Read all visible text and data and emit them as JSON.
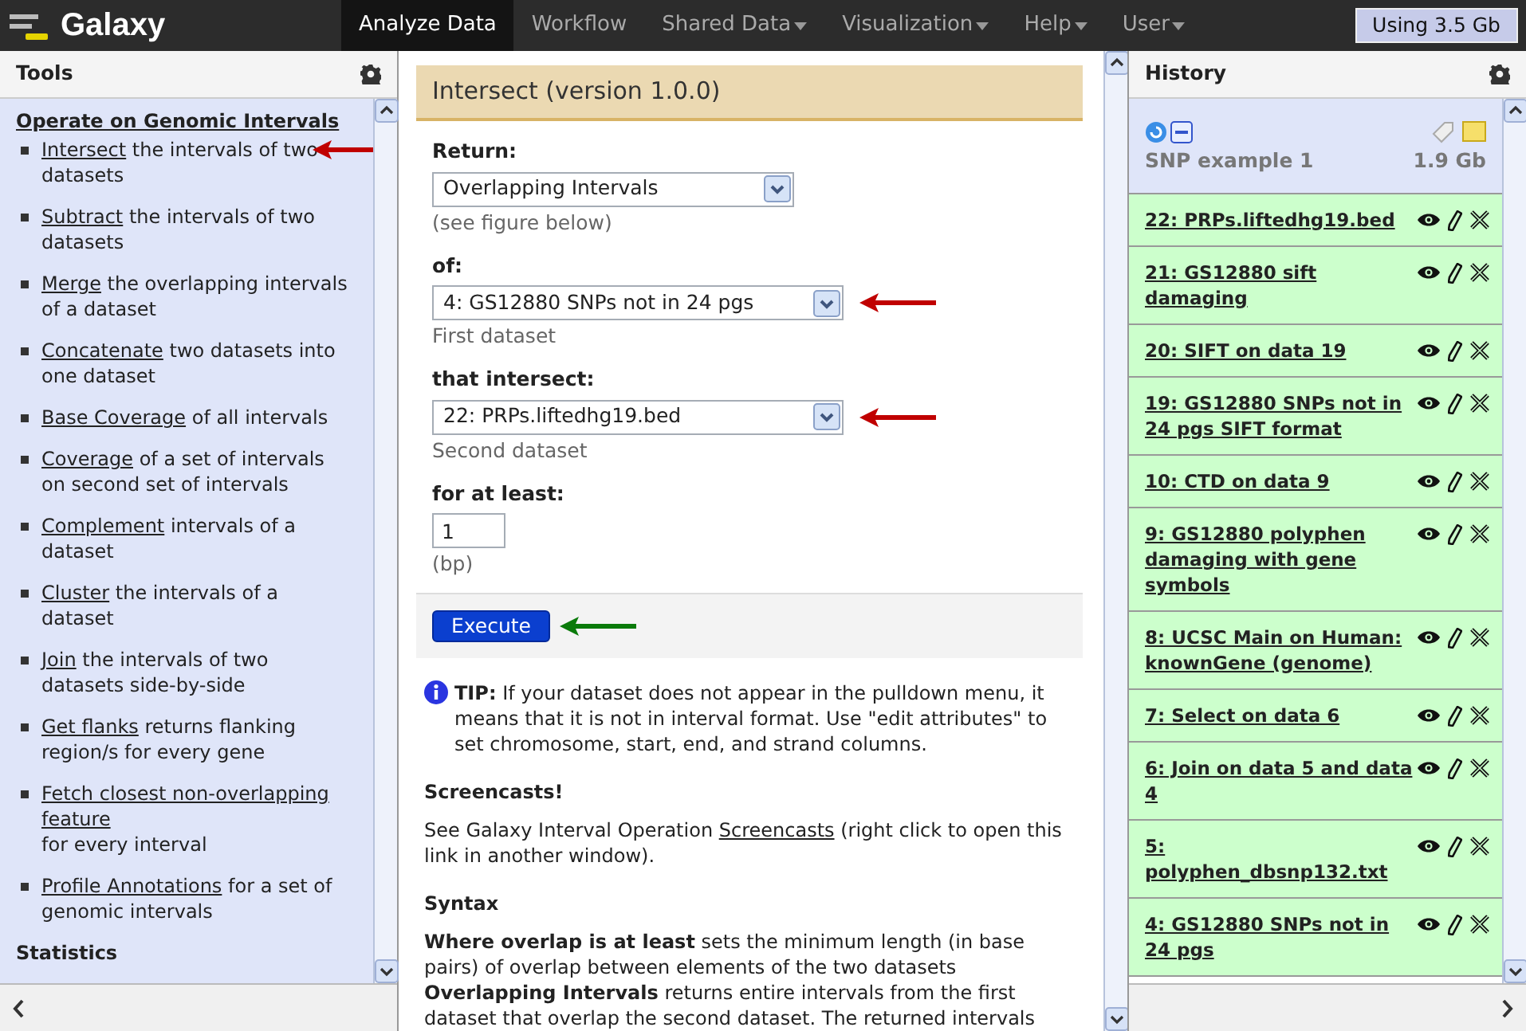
{
  "brand": {
    "name": "Galaxy"
  },
  "nav": [
    {
      "label": "Analyze Data",
      "selected": true,
      "dropdown": false
    },
    {
      "label": "Workflow",
      "selected": false,
      "dropdown": false
    },
    {
      "label": "Shared Data",
      "selected": false,
      "dropdown": true
    },
    {
      "label": "Visualization",
      "selected": false,
      "dropdown": true
    },
    {
      "label": "Help",
      "selected": false,
      "dropdown": true
    },
    {
      "label": "User",
      "selected": false,
      "dropdown": true
    }
  ],
  "usage": "Using 3.5 Gb",
  "tools": {
    "title": "Tools",
    "section": "Operate on Genomic Intervals",
    "items": [
      {
        "link": "Intersect",
        "text": " the intervals of two datasets",
        "pointed": true
      },
      {
        "link": "Subtract",
        "text": " the intervals of two datasets",
        "pointed": false
      },
      {
        "link": "Merge",
        "text": " the overlapping intervals of a dataset",
        "pointed": false
      },
      {
        "link": "Concatenate",
        "text": " two datasets into one dataset",
        "pointed": false
      },
      {
        "link": "Base Coverage",
        "text": " of all intervals",
        "pointed": false
      },
      {
        "link": "Coverage",
        "text": " of a set of intervals on second set of intervals",
        "pointed": false
      },
      {
        "link": "Complement",
        "text": " intervals of a dataset",
        "pointed": false
      },
      {
        "link": "Cluster",
        "text": " the intervals of a dataset",
        "pointed": false
      },
      {
        "link": "Join",
        "text": " the intervals of two datasets side-by-side",
        "pointed": false
      },
      {
        "link": "Get flanks",
        "text": " returns flanking region/s for every gene",
        "pointed": false
      },
      {
        "link": "Fetch closest non-overlapping feature",
        "text": " for every interval",
        "pointed": false
      },
      {
        "link": "Profile Annotations",
        "text": " for a set of genomic intervals",
        "pointed": false
      }
    ],
    "next_section": "Statistics"
  },
  "form": {
    "title": "Intersect (version 1.0.0)",
    "fields": [
      {
        "kind": "select",
        "label": "Return:",
        "value": "Overlapping Intervals",
        "help": "(see figure below)",
        "pointed": false
      },
      {
        "kind": "select",
        "label": "of:",
        "value": "4: GS12880 SNPs not in 24 pgs",
        "help": "First dataset",
        "pointed": true
      },
      {
        "kind": "select",
        "label": "that intersect:",
        "value": "22: PRPs.liftedhg19.bed",
        "help": "Second dataset",
        "pointed": true
      },
      {
        "kind": "text",
        "label": "for at least:",
        "value": "1",
        "help": "(bp)",
        "pointed": false
      }
    ],
    "execute": "Execute",
    "execute_pointed": true,
    "tip": "**TIP:** If your dataset does not appear in the pulldown menu, it means that it is not in interval format. Use \"edit attributes\" to set chromosome, start, end, and strand columns.",
    "screencasts_heading": "Screencasts!",
    "screencasts_before": "See Galaxy Interval Operation ",
    "screencasts_link": "Screencasts",
    "screencasts_after": " (right click to open this link in another window).",
    "syntax_heading": "Syntax",
    "syntax": "**Where overlap is at least** sets the minimum length (in base pairs) of overlap between elements of the two datasets **Overlapping Intervals** returns entire intervals from the first dataset that overlap the second dataset. The returned intervals"
  },
  "history": {
    "title": "History",
    "name": "SNP example 1",
    "size": "1.9 Gb",
    "items": [
      {
        "title": "22: PRPs.liftedhg19.bed"
      },
      {
        "title": "21: GS12880 sift damaging"
      },
      {
        "title": "20: SIFT on data 19"
      },
      {
        "title": "19: GS12880 SNPs not in 24 pgs SIFT format"
      },
      {
        "title": "10: CTD on data 9"
      },
      {
        "title": "9: GS12880 polyphen damaging with gene symbols"
      },
      {
        "title": "8: UCSC Main on Human: knownGene (genome)"
      },
      {
        "title": "7: Select on data 6"
      },
      {
        "title": "6: Join on data 5 and data 4"
      },
      {
        "title": "5: polyphen_dbsnp132.txt"
      },
      {
        "title": "4: GS12880 SNPs not in 24 pgs"
      }
    ]
  }
}
